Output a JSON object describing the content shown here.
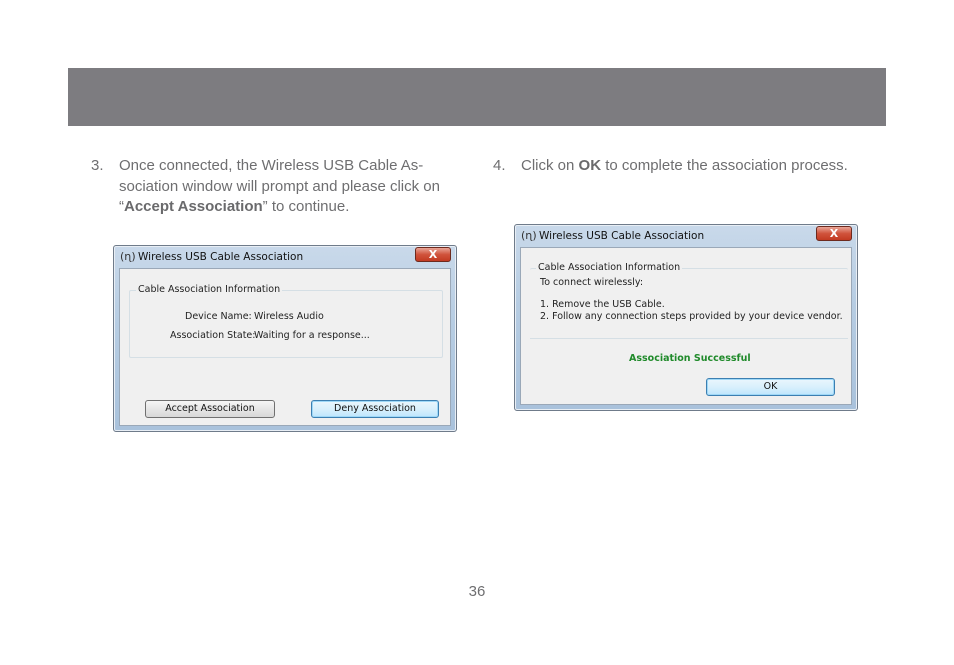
{
  "step3": {
    "number": "3.",
    "text_before": "Once connected, the Wireless USB Cable As-sociation window will prompt and please click on “",
    "bold": "Accept Association",
    "text_after": "” to continue."
  },
  "step4": {
    "number": "4.",
    "text_before": "Click on ",
    "bold": "OK",
    "text_after": " to complete the association process."
  },
  "dialog1": {
    "title": "Wireless USB Cable Association",
    "close_label": "X",
    "group_label": "Cable Association Information",
    "device_name_label": "Device Name:",
    "device_name_value": "Wireless Audio",
    "association_state_label": "Association State:",
    "association_state_value": "Waiting for a response...",
    "accept_button": "Accept Association",
    "deny_button": "Deny Association"
  },
  "dialog2": {
    "title": "Wireless USB Cable Association",
    "close_label": "X",
    "group_label": "Cable Association Information",
    "line1": "To connect wirelessly:",
    "line2": "1.  Remove the USB Cable.",
    "line3": "2.  Follow any connection steps provided by your device vendor.",
    "status": "Association Successful",
    "ok_button": "OK"
  },
  "icons": {
    "app_icon": "(ɳ)"
  },
  "page_number": "36"
}
